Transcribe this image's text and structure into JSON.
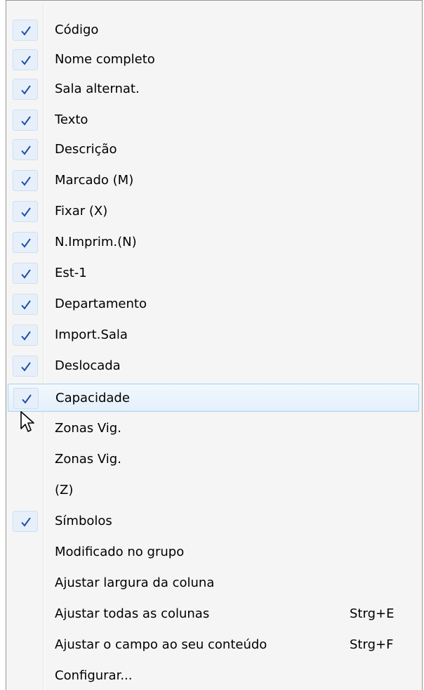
{
  "colors": {
    "check_color": "#1e4fa8",
    "hover_border": "#a8d2f0"
  },
  "icons": {
    "check": "checkmark-icon",
    "cursor": "mouse-pointer-icon"
  },
  "menu": {
    "items": [
      {
        "label": "Código",
        "checked": true
      },
      {
        "label": "Nome completo",
        "checked": true
      },
      {
        "label": "Sala alternat.",
        "checked": true
      },
      {
        "label": "Texto",
        "checked": true
      },
      {
        "label": "Descrição",
        "checked": true
      },
      {
        "label": "Marcado (M)",
        "checked": true
      },
      {
        "label": "Fixar (X)",
        "checked": true
      },
      {
        "label": "N.Imprim.(N)",
        "checked": true
      },
      {
        "label": "Est-1",
        "checked": true
      },
      {
        "label": "Departamento",
        "checked": true
      },
      {
        "label": "Import.Sala",
        "checked": true
      },
      {
        "label": "Deslocada",
        "checked": true
      },
      {
        "label": "Capacidade",
        "checked": true,
        "hovered": true
      },
      {
        "label": "Zonas Vig.",
        "checked": false
      },
      {
        "label": "Zonas Vig.",
        "checked": false
      },
      {
        "label": "(Z)",
        "checked": false
      },
      {
        "label": "Símbolos",
        "checked": true
      },
      {
        "label": "Modificado no grupo",
        "checked": false
      },
      {
        "label": "Ajustar largura da coluna",
        "checked": false
      },
      {
        "label": "Ajustar todas as colunas",
        "checked": false,
        "shortcut": "Strg+E"
      },
      {
        "label": "Ajustar o campo ao seu conteúdo",
        "checked": false,
        "shortcut": "Strg+F"
      },
      {
        "label": "Configurar...",
        "checked": false
      }
    ]
  }
}
